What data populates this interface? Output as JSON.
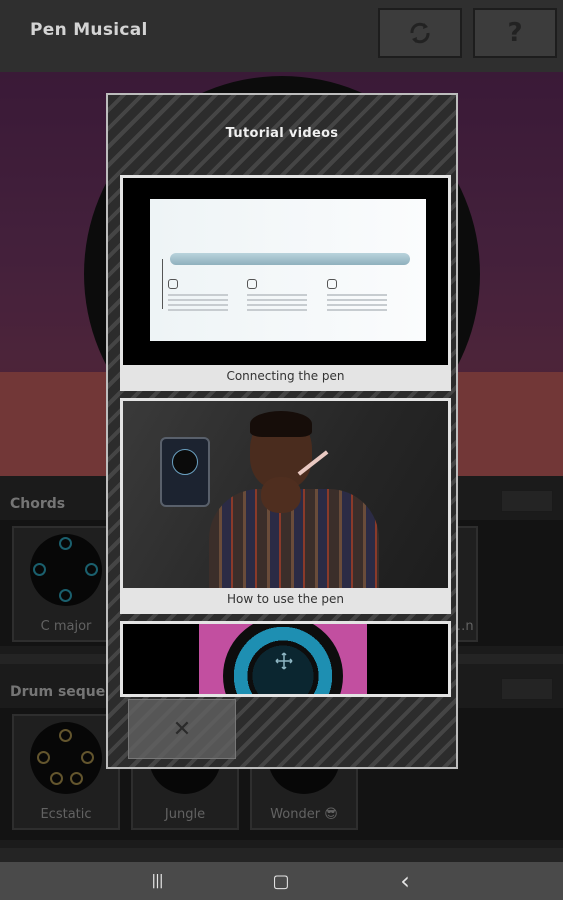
{
  "app": {
    "title": "Pen Musical"
  },
  "header": {
    "refresh_icon": "refresh-icon",
    "help_label": "?"
  },
  "sections": {
    "chords": {
      "title": "Chords",
      "items": [
        {
          "label": "C major",
          "accent": "#2a9ab0"
        },
        {
          "label": "",
          "accent": "#2a9ab0"
        },
        {
          "label": "",
          "accent": "#2a9ab0"
        },
        {
          "label": "…n",
          "accent": "#2a9ab0"
        }
      ]
    },
    "drums": {
      "title": "Drum sequence",
      "items": [
        {
          "label": "Ecstatic",
          "accent": "#a08a4a"
        },
        {
          "label": "Jungle",
          "accent": "#a08a4a"
        },
        {
          "label": "Wonder 😎",
          "accent": "#a08a4a"
        }
      ]
    }
  },
  "dialog": {
    "title": "Tutorial videos",
    "videos": [
      {
        "caption": "Connecting the pen"
      },
      {
        "caption": "How to use the pen"
      },
      {
        "caption": ""
      }
    ],
    "close_label": "✕"
  },
  "navbar": {
    "recents_label": "|||",
    "home_label": "▢",
    "back_label": "‹"
  },
  "colors": {
    "accent_teal": "#2a9ab0",
    "accent_gold": "#a08a4a",
    "dialog_border": "#bdbdbd"
  }
}
